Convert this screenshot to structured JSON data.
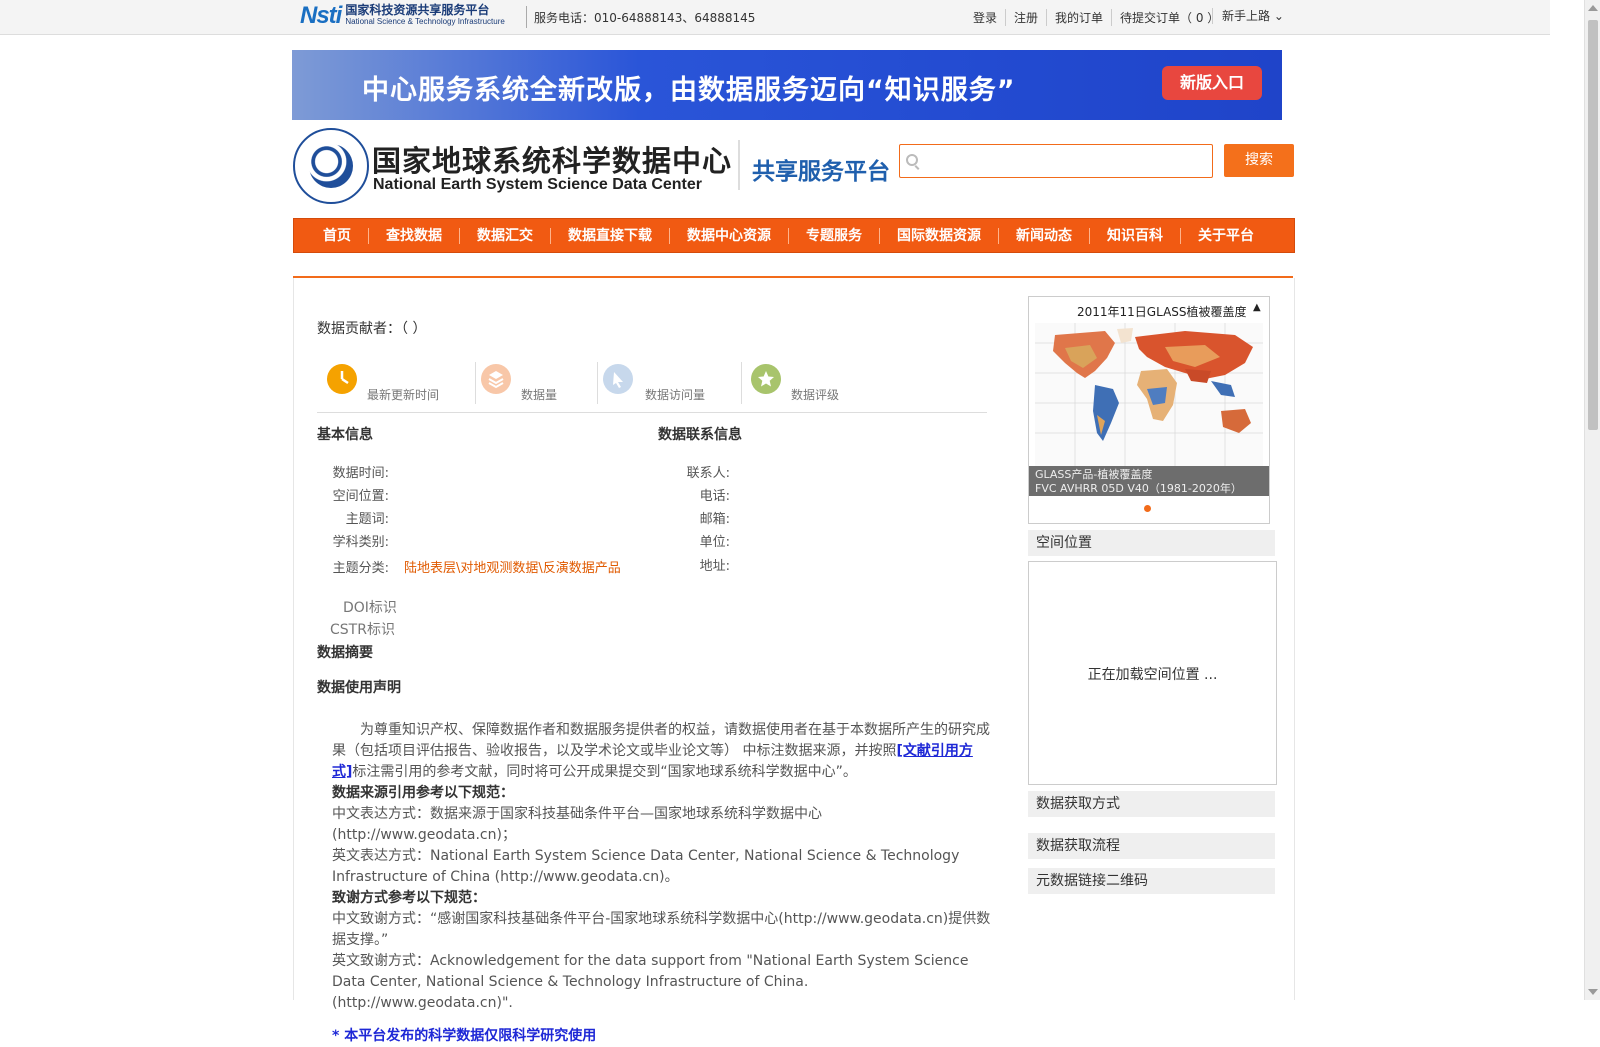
{
  "topbar": {
    "brand_mark": "Nsti",
    "brand_cn": "国家科技资源共享服务平台",
    "brand_en": "National Science & Technology Infrastructure",
    "hotline_label": "服务电话：",
    "hotline_numbers": "010-64888143、64888145",
    "links": [
      "登录",
      "注册",
      "我的订单",
      "待提交订单（ 0 ）"
    ],
    "guide": "新手上路"
  },
  "banner": {
    "text": "中心服务系统全新改版，由数据服务迈向“知识服务”",
    "button": "新版入口"
  },
  "header": {
    "org_cn": "国家地球系统科学数据中心",
    "org_en": "National Earth System Science Data Center",
    "platform": "共享服务平台",
    "search_placeholder": "",
    "search_button": "搜索"
  },
  "nav": [
    "首页",
    "查找数据",
    "数据汇交",
    "数据直接下载",
    "数据中心资源",
    "专题服务",
    "国际数据资源",
    "新闻动态",
    "知识百科",
    "关于平台"
  ],
  "main": {
    "contributor": "数据贡献者：（ ）",
    "stats": [
      "最新更新时间",
      "数据量",
      "数据访问量",
      "数据评级"
    ],
    "basic_title": "基本信息",
    "basic_fields": [
      "数据时间:",
      "空间位置:",
      "主题词:",
      "学科类别:",
      "主题分类:"
    ],
    "topic_value": "陆地表层\\对地观测数据\\反演数据产品",
    "contact_title": "数据联系信息",
    "contact_fields": [
      "联系人:",
      "电话:",
      "邮箱:",
      "单位:",
      "地址:"
    ],
    "doi_label": "DOI标识",
    "cstr_label": "CSTR标识",
    "abstract_title": "数据摘要",
    "declaration_title": "数据使用声明",
    "decl_p1_a": "为尊重知识产权、保障数据作者和数据服务提供者的权益，请数据使用者在基于本数据所产生的研究成果（包括项目评估报告、验收报告，以及学术论文或毕业论文等） 中标注数据来源，并按照",
    "decl_p1_link": "[文献引用方式]",
    "decl_p1_b": "标注需引用的参考文献，同时将可公开成果提交到“国家地球系统科学数据中心”。",
    "cite_title": "数据来源引用参考以下规范：",
    "cite_cn": "中文表达方式：数据来源于国家科技基础条件平台—国家地球系统科学数据中心(http://www.geodata.cn)；",
    "cite_en": "英文表达方式：National Earth System Science Data Center, National Science & Technology Infrastructure of China (http://www.geodata.cn)。",
    "ack_title": "致谢方式参考以下规范：",
    "ack_cn": "中文致谢方式：“感谢国家科技基础条件平台-国家地球系统科学数据中心(http://www.geodata.cn)提供数据支撑。”",
    "ack_en": "英文致谢方式：Acknowledgement for the data support from \"National Earth System Science Data Center, National Science & Technology Infrastructure of China. (http://www.geodata.cn)\".",
    "footer_note": "* 本平台发布的科学数据仅限科学研究使用"
  },
  "sidebar": {
    "slide_title": "2011年11日GLASS植被覆盖度",
    "slide_caption_1": "GLASS产品-植被覆盖度",
    "slide_caption_2": "FVC AVHRR 05D V40（1981-2020年）",
    "spatial_title": "空间位置",
    "spatial_loading": "正在加载空间位置 ...",
    "access_title": "数据获取方式",
    "flow_title": "数据获取流程",
    "qrcode_title": "元数据链接二维码"
  },
  "colors": {
    "accent": "#f15a12",
    "link": "#1e28d6",
    "brand_blue": "#1f5fad"
  }
}
